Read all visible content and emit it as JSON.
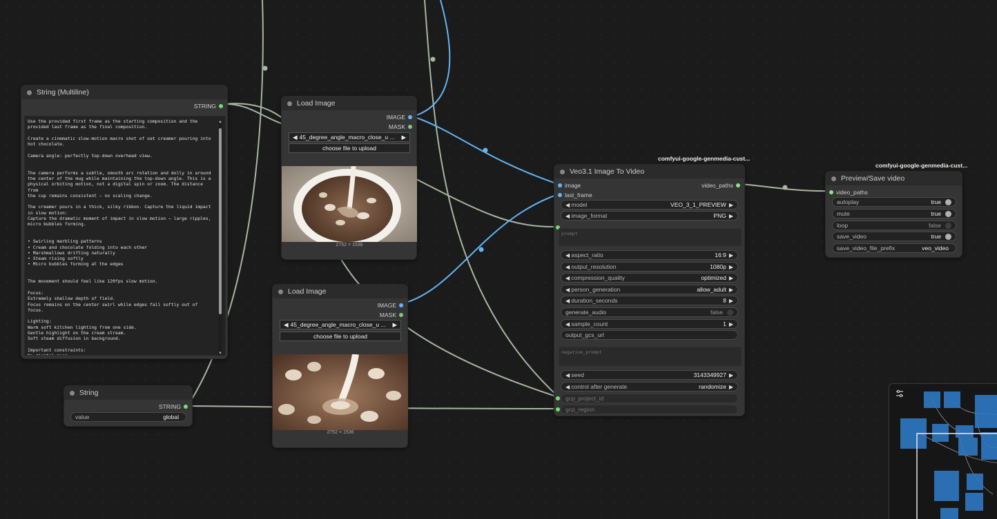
{
  "nodes": {
    "string_multiline": {
      "title": "String (Multiline)",
      "output_label": "STRING",
      "text": "Use the provided first frame as the starting composition and the\nprovided last frame as the final composition.\n\nCreate a cinematic slow-motion macro shot of oat creamer pouring into\nhot chocolate.\n\nCamera angle: perfectly top-down overhead view.\n\n\nThe camera performs a subtle, smooth arc rotation and dolly in around\nthe center of the mug while maintaining the top-down angle. This is a\nphysical orbiting motion, not a digital spin or zoom. The distance from\nthe cup remains consistent — no scaling change.\n\nThe creamer pours in a thick, silky ribbon. Capture the liquid impact\nin slow motion:\nCapture the dramatic moment of impact in slow motion — large ripples,\nmicro bubbles forming.\n\n\n• Swirling marbling patterns\n• Cream and chocolate folding into each other\n• Marshmallows drifting naturally\n• Steam rising softly\n• Micro bubbles forming at the edges\n\n\nThe movement should feel like 120fps slow motion.\n\nFocus:\nExtremely shallow depth of field.\nFocus remains on the center swirl while edges fall softly out of focus.\n\nLighting:\nWarm soft kitchen lighting from one side.\nGentle highlight on the cream stream.\nSoft steam diffusion in background.\n\nImportant constraints:\nNo digital zoom.\nNo distortion of mug geometry.\nNo warping of marshmallows."
    },
    "load_image_1": {
      "title": "Load Image",
      "outputs": [
        "IMAGE",
        "MASK"
      ],
      "file": "45_degree_angle_macro_close_u ...",
      "upload_label": "choose file to upload",
      "size": "2752 × 1536"
    },
    "load_image_2": {
      "title": "Load Image",
      "outputs": [
        "IMAGE",
        "MASK"
      ],
      "file": "45_degree_angle_macro_close_u ...",
      "upload_label": "choose file to upload",
      "size": "2752 × 1536"
    },
    "string": {
      "title": "String",
      "output_label": "STRING",
      "value_label": "value",
      "value": "global"
    },
    "veo": {
      "badge": "comfyui-google-genmedia-cust...",
      "title": "Veo3.1 Image To Video",
      "inputs": [
        "image",
        "last_frame"
      ],
      "output_label": "video_paths",
      "prompt_placeholder": "prompt",
      "negative_placeholder": "negative_prompt",
      "widgets_a": [
        {
          "label": "model",
          "value": "VEO_3_1_PREVIEW"
        },
        {
          "label": "image_format",
          "value": "PNG"
        }
      ],
      "widgets_b": [
        {
          "label": "aspect_ratio",
          "value": "16:9"
        },
        {
          "label": "output_resolution",
          "value": "1080p"
        },
        {
          "label": "compression_quality",
          "value": "optimized"
        },
        {
          "label": "person_generation",
          "value": "allow_adult"
        },
        {
          "label": "duration_seconds",
          "value": "8"
        }
      ],
      "generate_audio": {
        "label": "generate_audio",
        "value": "false"
      },
      "sample_count": {
        "label": "sample_count",
        "value": "1"
      },
      "output_gcs_url": {
        "label": "output_gcs_url"
      },
      "seed": {
        "label": "seed",
        "value": "3143349927"
      },
      "control_after_generate": {
        "label": "control after generate",
        "value": "randomize"
      },
      "gcp_project_id": {
        "label": "gcp_project_id"
      },
      "gcp_region": {
        "label": "gcp_region"
      }
    },
    "preview": {
      "badge": "comfyui-google-genmedia-cust...",
      "title": "Preview/Save video",
      "input_label": "video_paths",
      "autoplay": {
        "label": "autoplay",
        "value": "true"
      },
      "mute": {
        "label": "mute",
        "value": "true"
      },
      "loop": {
        "label": "loop",
        "value": "false"
      },
      "save_video": {
        "label": "save_video",
        "value": "true"
      },
      "prefix": {
        "label": "save_video_file_prefix",
        "value": "veo_video"
      }
    }
  },
  "minimap": {
    "settings_icon": "sliders-icon"
  },
  "colors": {
    "canvas": "#1b1b1b",
    "node": "#353535",
    "wire_string": "#a9b7a3",
    "wire_image": "#64b5f6"
  }
}
